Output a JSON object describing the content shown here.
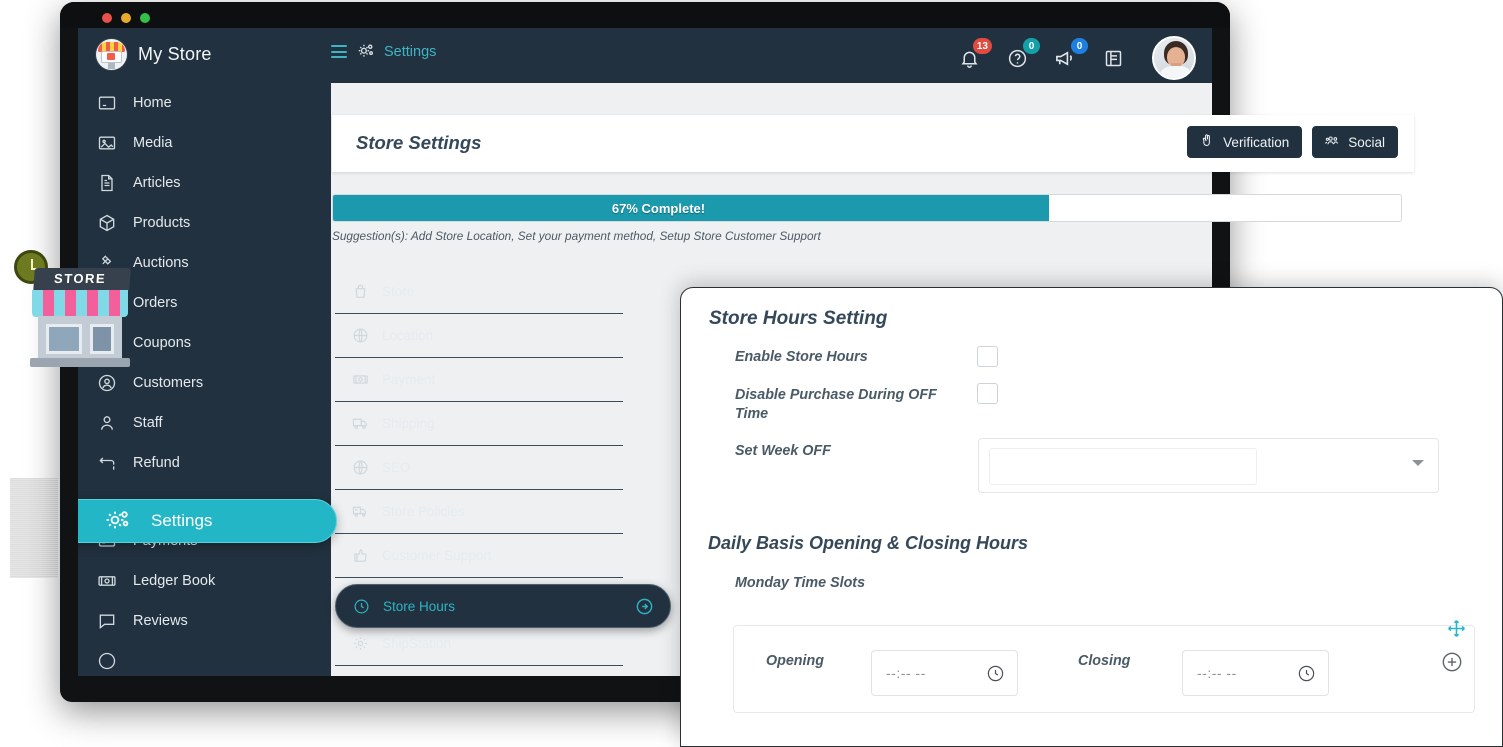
{
  "window": {
    "traffic_lights": [
      "close",
      "minimize",
      "maximize"
    ]
  },
  "topbar": {
    "brand_name": "My Store",
    "brand_logo_icon": "store-logo-icon",
    "menu_icon": "hamburger-menu-icon",
    "settings_gear_icon": "gear-icon",
    "nav_label": "Settings",
    "icons": [
      {
        "name": "notifications-bell-icon",
        "badge": "13",
        "badge_color": "#e04a3f"
      },
      {
        "name": "help-question-icon",
        "badge": "0",
        "badge_color": "#15a0a8"
      },
      {
        "name": "announcement-megaphone-icon",
        "badge": "0",
        "badge_color": "#1f7fe0"
      },
      {
        "name": "book-icon",
        "badge": "",
        "badge_color": ""
      }
    ],
    "avatar_alt": "user-avatar"
  },
  "sidebar": {
    "items": [
      {
        "label": "Home",
        "icon": "home-icon",
        "active": false
      },
      {
        "label": "Media",
        "icon": "image-icon",
        "active": false
      },
      {
        "label": "Articles",
        "icon": "document-icon",
        "active": false
      },
      {
        "label": "Products",
        "icon": "box-icon",
        "active": false
      },
      {
        "label": "Auctions",
        "icon": "gavel-icon",
        "active": false
      },
      {
        "label": "Orders",
        "icon": "orders-icon",
        "active": false
      },
      {
        "label": "Coupons",
        "icon": "gift-icon",
        "active": false
      },
      {
        "label": "Customers",
        "icon": "user-circle-icon",
        "active": false
      },
      {
        "label": "Staff",
        "icon": "person-icon",
        "active": false
      },
      {
        "label": "Refund",
        "icon": "refund-arrow-icon",
        "active": false
      },
      {
        "label": "Settings",
        "icon": "gear-icon",
        "active": true
      },
      {
        "label": "Payments",
        "icon": "credit-card-icon",
        "active": false
      },
      {
        "label": "Ledger Book",
        "icon": "money-icon",
        "active": false
      },
      {
        "label": "Reviews",
        "icon": "comment-icon",
        "active": false
      }
    ]
  },
  "page": {
    "title": "Store Settings",
    "header_buttons": [
      {
        "label": "Verification",
        "icon": "hand-peace-icon"
      },
      {
        "label": "Social",
        "icon": "users-group-icon"
      }
    ],
    "progress": {
      "percent": 67,
      "label": "67% Complete!",
      "fill_color": "#1b9aad",
      "suggestion": "Suggestion(s): Add Store Location, Set your payment method, Setup Store Customer Support"
    },
    "settings_tabs": [
      {
        "label": "Store",
        "icon": "bag-icon",
        "active": false
      },
      {
        "label": "Location",
        "icon": "globe-icon",
        "active": false
      },
      {
        "label": "Payment",
        "icon": "money-icon",
        "active": false
      },
      {
        "label": "Shipping",
        "icon": "truck-icon",
        "active": false
      },
      {
        "label": "SEO",
        "icon": "globe-icon",
        "active": false
      },
      {
        "label": "Store Policies",
        "icon": "policy-truck-icon",
        "active": false
      },
      {
        "label": "Customer Support",
        "icon": "thumbs-up-icon",
        "active": false
      },
      {
        "label": "Store Hours",
        "icon": "clock-icon",
        "active": true
      },
      {
        "label": "ShipStation",
        "icon": "gear-icon",
        "active": false
      }
    ],
    "active_tab_arrow_icon": "arrow-circle-right-icon"
  },
  "store_hours": {
    "section_title": "Store Hours Setting",
    "enable_label": "Enable Store Hours",
    "enable_checked": false,
    "disable_purchase_label": "Disable Purchase During OFF Time",
    "disable_purchase_checked": false,
    "week_off_label": "Set Week OFF",
    "week_off_value": "",
    "week_off_placeholder": "",
    "daily_title": "Daily Basis Opening & Closing Hours",
    "day_title": "Monday Time Slots",
    "opening_label": "Opening",
    "opening_value": "--:-- --",
    "closing_label": "Closing",
    "closing_value": "--:-- --",
    "clock_icon": "clock-icon",
    "move_icon": "move-arrows-icon",
    "add_icon": "plus-circle-icon",
    "accent_color": "#29b8c9"
  },
  "decoration": {
    "store_illustration_label": "STORE",
    "store_icon": "store-3d-illustration",
    "clock_icon": "wall-clock-icon"
  }
}
